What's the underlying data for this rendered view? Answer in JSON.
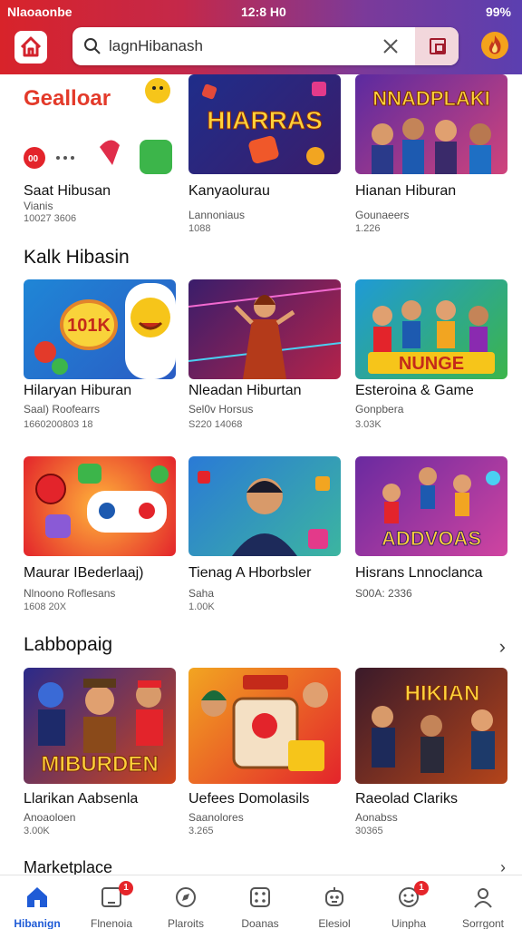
{
  "status": {
    "left": "Nlaoaonbe",
    "time": "12:8 H0",
    "battery": "99%"
  },
  "search": {
    "query": "lagnHibanash"
  },
  "colors": {
    "accent": "#1f5bd6",
    "header_start": "#d8232a",
    "header_end": "#5b3fb0",
    "badge": "#e5252a"
  },
  "rows": [
    {
      "cards": [
        {
          "title": "Saat Hibusan",
          "sub": "Vianis",
          "meta": "10027 3606",
          "thumb_text": "Gealloar"
        },
        {
          "title": "Kanyaolurau",
          "sub": "Lannoniaus",
          "meta": "1088",
          "thumb_text": "HIARRAS"
        },
        {
          "title": "Hianan Hiburan",
          "sub": "Gounaeers",
          "meta": "1.226",
          "thumb_text": "NNADPLAKI"
        }
      ]
    },
    {
      "section": "Kalk Hibasin",
      "cards": [
        {
          "title": "Hilaryan Hiburan",
          "sub": "Saal) Roofearrs",
          "meta": "1660200803 18",
          "thumb_text": "101K"
        },
        {
          "title": "Nleadan Hiburtan",
          "sub": "Sel0v Horsus",
          "meta": "S220 14068",
          "thumb_text": ""
        },
        {
          "title": "Esteroina & Game",
          "sub": "Gonpbera",
          "meta": "3.03K",
          "thumb_text": "NUNGE"
        }
      ]
    },
    {
      "cards": [
        {
          "title": "Maurar IBederlaaj)",
          "sub": "Nlnoono Roflesans",
          "meta": "1608 20X",
          "thumb_text": ""
        },
        {
          "title": "Tienag A Hborbsler",
          "sub": "Saha",
          "meta": "1.00K",
          "thumb_text": ""
        },
        {
          "title": "Hisrans Lnnoclanca",
          "sub": "S00A: 2336",
          "meta": "",
          "thumb_text": "ADDVOAS"
        }
      ]
    },
    {
      "section": "Labbopaig",
      "cards": [
        {
          "title": "Llarikan Aabsenla",
          "sub": "Anoaoloen",
          "meta": "3.00K",
          "thumb_text": "MIBURDEN"
        },
        {
          "title": "Uefees Domolasils",
          "sub": "Saanolores",
          "meta": "3.265",
          "thumb_text": ""
        },
        {
          "title": "Raeolad Clariks",
          "sub": "Aonabss",
          "meta": "30365",
          "thumb_text": "HIKIAN"
        }
      ]
    }
  ],
  "section_last": "Marketplace",
  "nav": [
    {
      "label": "Hibanign",
      "icon": "home-icon",
      "badge": ""
    },
    {
      "label": "Flnenoia",
      "icon": "tablet-icon",
      "badge": "1"
    },
    {
      "label": "Plaroits",
      "icon": "compass-icon",
      "badge": ""
    },
    {
      "label": "Doanas",
      "icon": "dice-icon",
      "badge": ""
    },
    {
      "label": "Elesiol",
      "icon": "robot-icon",
      "badge": ""
    },
    {
      "label": "Uinpha",
      "icon": "smile-icon",
      "badge": "1"
    },
    {
      "label": "Sorrgont",
      "icon": "user-icon",
      "badge": ""
    }
  ]
}
